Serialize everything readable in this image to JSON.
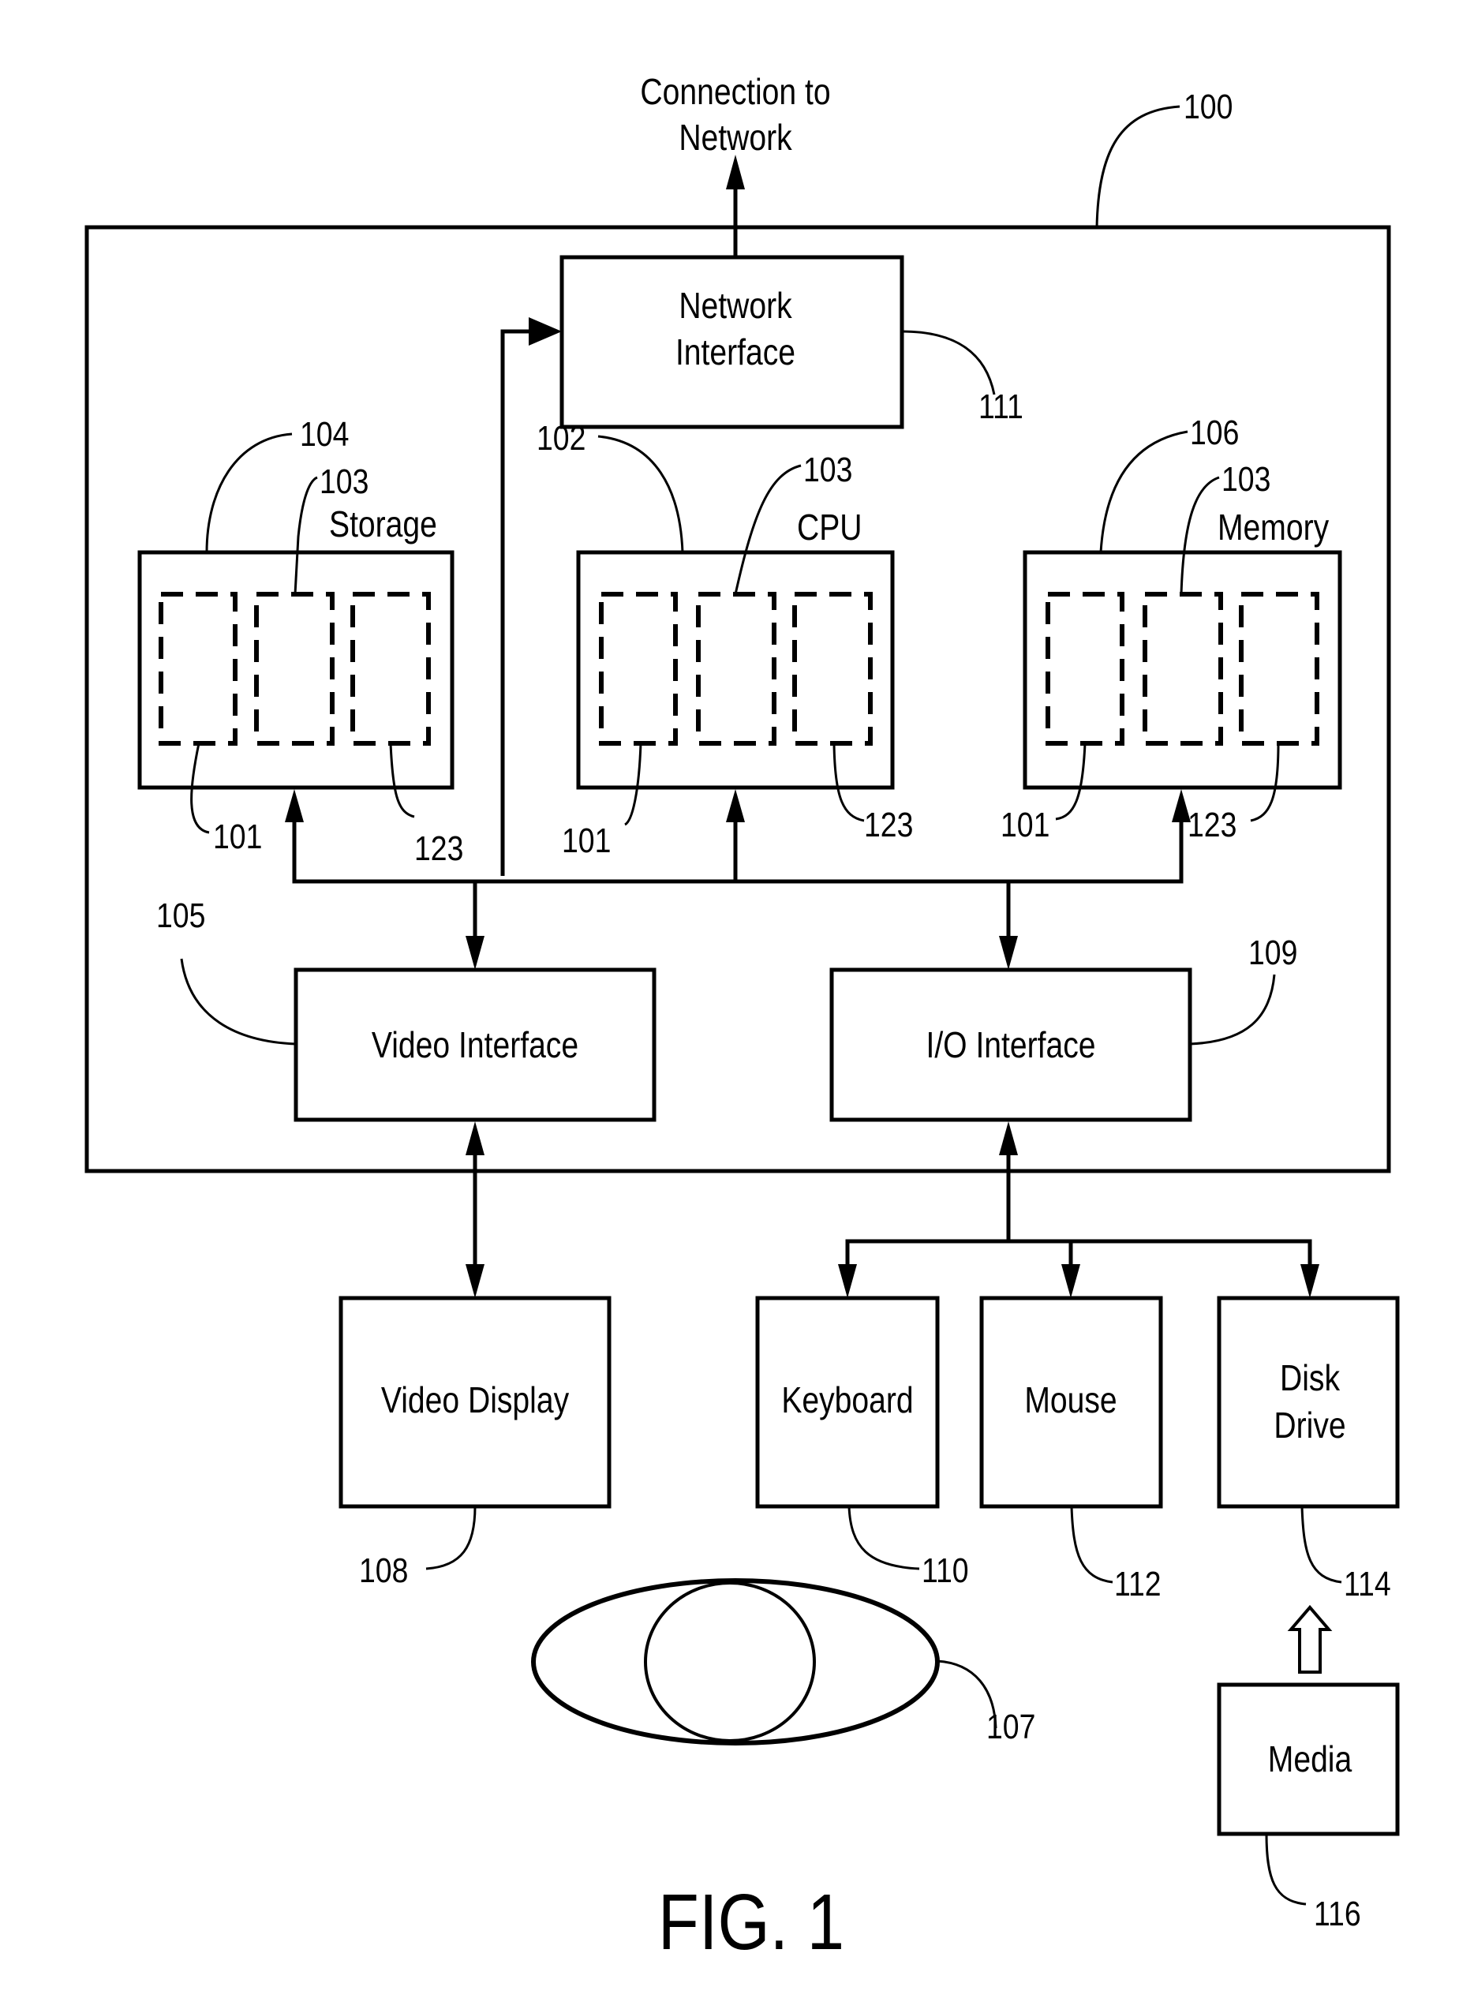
{
  "figure": {
    "caption": "FIG. 1",
    "external_label": [
      "Connection to",
      "Network"
    ],
    "components": {
      "network_interface": {
        "lines": [
          "Network",
          "Interface"
        ],
        "ref": "111"
      },
      "storage": {
        "label": "Storage",
        "ref": "104",
        "sub_ref": "103",
        "left_ref": "101",
        "right_ref": "123"
      },
      "cpu": {
        "label": "CPU",
        "ref": "102",
        "sub_ref": "103",
        "left_ref": "101",
        "right_ref": "123"
      },
      "memory": {
        "label": "Memory",
        "ref": "106",
        "sub_ref": "103",
        "left_ref": "101",
        "right_ref": "123"
      },
      "video_interface": {
        "label": "Video Interface",
        "ref": "105"
      },
      "io_interface": {
        "label": "I/O Interface",
        "ref": "109"
      },
      "video_display": {
        "label": "Video Display",
        "ref": "108"
      },
      "keyboard": {
        "label": "Keyboard",
        "ref": "110"
      },
      "mouse": {
        "label": "Mouse",
        "ref": "112"
      },
      "disk_drive": {
        "lines": [
          "Disk",
          "Drive"
        ],
        "ref": "114"
      },
      "media": {
        "label": "Media",
        "ref": "116"
      },
      "mouse_device": {
        "ref": "107"
      }
    },
    "system_ref": "100"
  }
}
